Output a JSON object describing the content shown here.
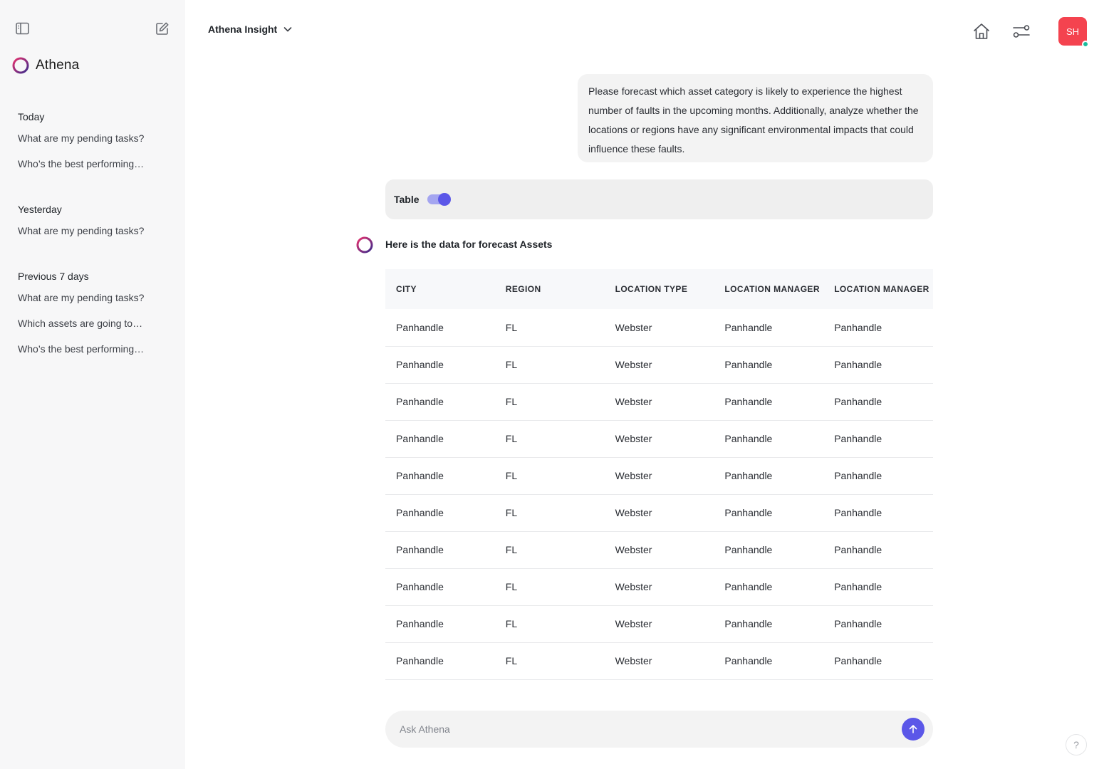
{
  "sidebar": {
    "brand": "Athena",
    "sections": [
      {
        "title": "Today",
        "items": [
          "What are my pending tasks?",
          "Who’s the best performing…"
        ]
      },
      {
        "title": "Yesterday",
        "items": [
          "What are my pending tasks?"
        ]
      },
      {
        "title": "Previous 7 days",
        "items": [
          "What are my pending tasks?",
          "Which assets are going to…",
          "Who’s the best performing…"
        ]
      }
    ]
  },
  "header": {
    "model": "Athena Insight",
    "avatar_initials": "SH"
  },
  "conversation": {
    "user_message": "Please forecast which asset category is likely to experience the highest number of faults in the upcoming months. Additionally, analyze whether the locations or regions have any significant environmental impacts that could influence these faults.",
    "toggle_label": "Table",
    "toggle_on": true,
    "bot_reply": "Here is the data for forecast Assets"
  },
  "table": {
    "columns": [
      "CITY",
      "REGION",
      "LOCATION TYPE",
      "LOCATION MANAGER",
      "LOCATION MANAGER"
    ],
    "rows": [
      [
        "Panhandle",
        "FL",
        "Webster",
        "Panhandle",
        "Panhandle"
      ],
      [
        "Panhandle",
        "FL",
        "Webster",
        "Panhandle",
        "Panhandle"
      ],
      [
        "Panhandle",
        "FL",
        "Webster",
        "Panhandle",
        "Panhandle"
      ],
      [
        "Panhandle",
        "FL",
        "Webster",
        "Panhandle",
        "Panhandle"
      ],
      [
        "Panhandle",
        "FL",
        "Webster",
        "Panhandle",
        "Panhandle"
      ],
      [
        "Panhandle",
        "FL",
        "Webster",
        "Panhandle",
        "Panhandle"
      ],
      [
        "Panhandle",
        "FL",
        "Webster",
        "Panhandle",
        "Panhandle"
      ],
      [
        "Panhandle",
        "FL",
        "Webster",
        "Panhandle",
        "Panhandle"
      ],
      [
        "Panhandle",
        "FL",
        "Webster",
        "Panhandle",
        "Panhandle"
      ],
      [
        "Panhandle",
        "FL",
        "Webster",
        "Panhandle",
        "Panhandle"
      ]
    ]
  },
  "input": {
    "placeholder": "Ask Athena",
    "value": ""
  },
  "help_label": "?",
  "colors": {
    "accent": "#5b57e8",
    "avatar": "#f4434f",
    "online": "#1abc9c"
  }
}
